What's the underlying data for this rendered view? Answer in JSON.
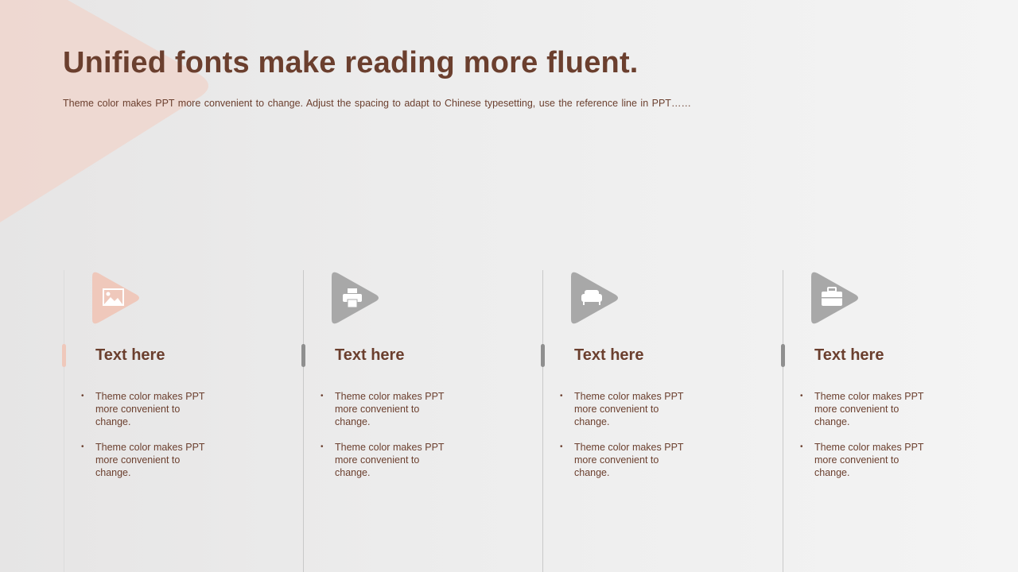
{
  "title": "Unified fonts make reading more fluent.",
  "subtitle": "Theme color makes PPT more convenient  to change.  Adjust  the spacing  to adapt to Chinese  typesetting, use the reference line  in  PPT……",
  "colors": {
    "accent_text": "#6b3f2e",
    "highlight": "#efc8bb",
    "muted": "#a8a8a8"
  },
  "columns": [
    {
      "icon": "image-icon",
      "active": true,
      "title": "Text here",
      "bullets": [
        "Theme  color makes PPT more convenient to change.",
        "Theme  color makes PPT more convenient to change."
      ]
    },
    {
      "icon": "printer-icon",
      "active": false,
      "title": "Text here",
      "bullets": [
        "Theme  color makes PPT more convenient to change.",
        "Theme  color makes PPT more convenient to change."
      ]
    },
    {
      "icon": "armchair-icon",
      "active": false,
      "title": "Text here",
      "bullets": [
        "Theme  color makes PPT more convenient to change.",
        "Theme  color makes PPT more convenient to change."
      ]
    },
    {
      "icon": "briefcase-icon",
      "active": false,
      "title": "Text here",
      "bullets": [
        "Theme  color makes PPT more convenient to change.",
        "Theme  color makes PPT more convenient to change."
      ]
    }
  ]
}
